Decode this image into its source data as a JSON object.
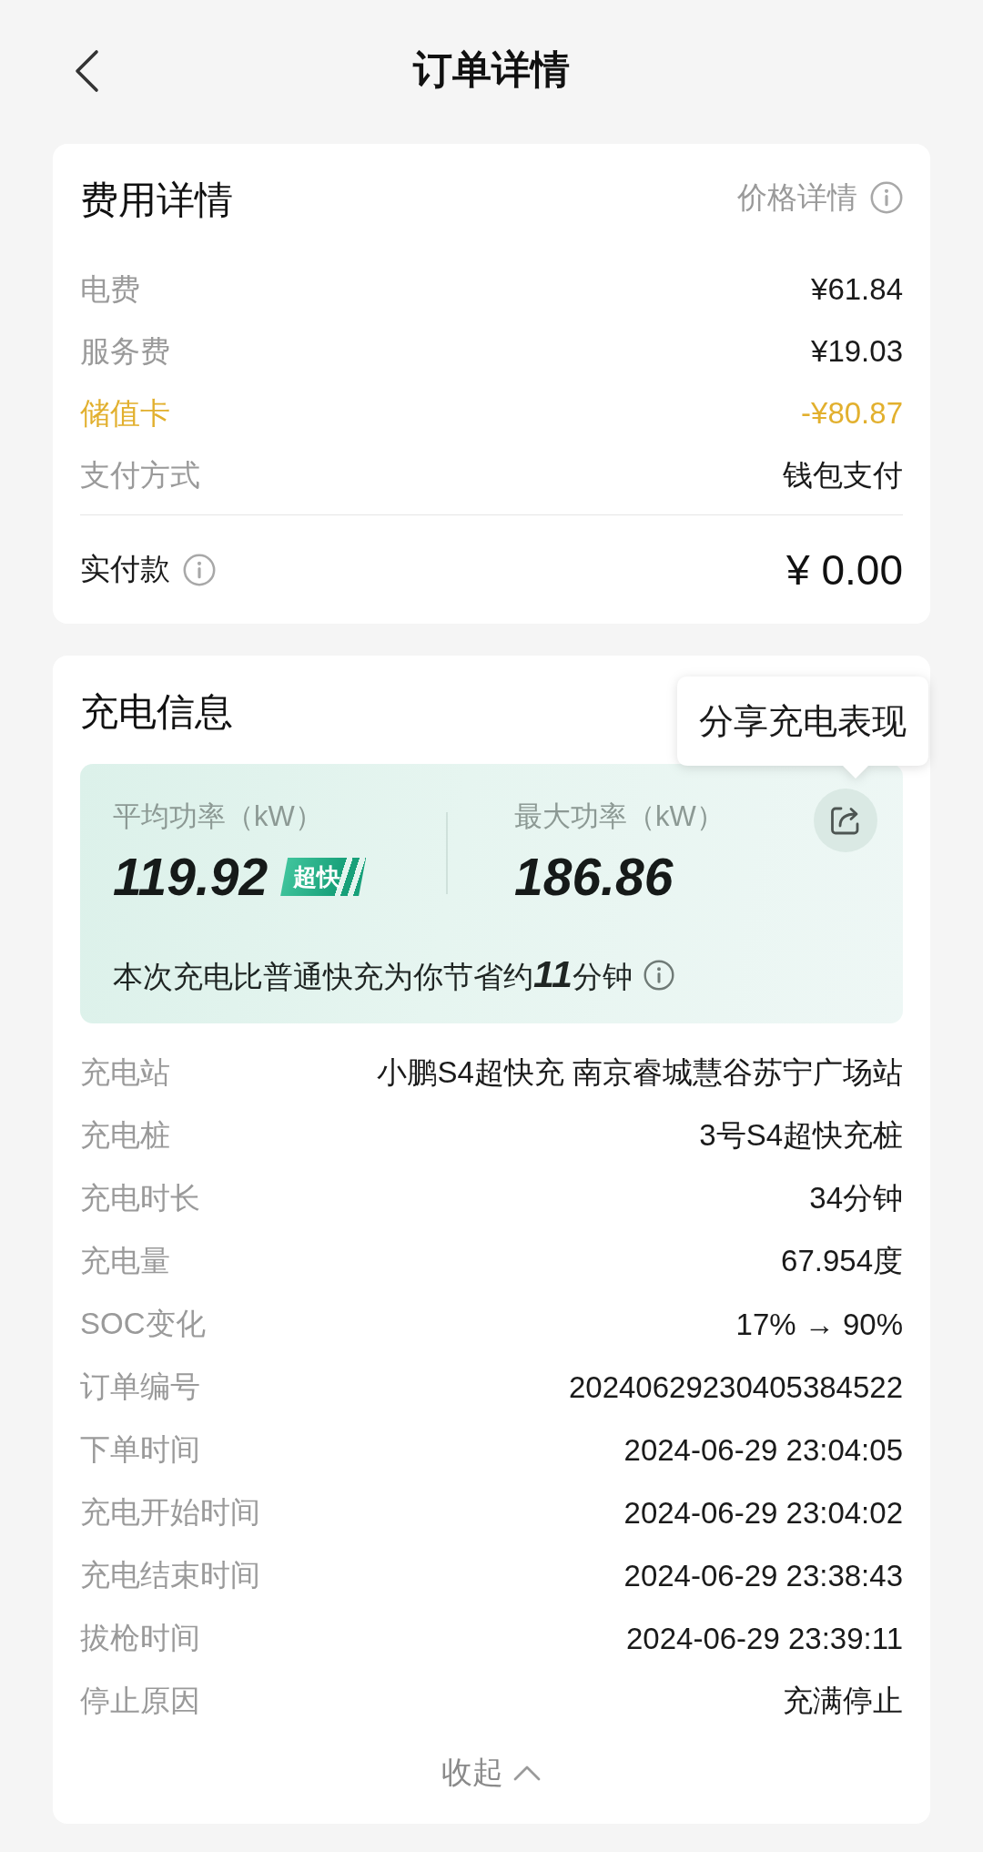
{
  "header": {
    "title": "订单详情"
  },
  "fee_details": {
    "title": "费用详情",
    "price_link": "价格详情",
    "rows": [
      {
        "label": "电费",
        "value": "¥61.84",
        "kind": "plain"
      },
      {
        "label": "服务费",
        "value": "¥19.03",
        "kind": "plain"
      },
      {
        "label": "储值卡",
        "value": "-¥80.87",
        "kind": "discount"
      },
      {
        "label": "支付方式",
        "value": "钱包支付",
        "kind": "plain"
      }
    ],
    "total": {
      "label": "实付款",
      "value": "¥ 0.00"
    }
  },
  "charging_info": {
    "title": "充电信息",
    "share_tooltip": "分享充电表现",
    "stats": [
      {
        "label": "平均功率（kW）",
        "value": "119.92",
        "badge": "超快"
      },
      {
        "label": "最大功率（kW）",
        "value": "186.86"
      }
    ],
    "savings_note": "本次充电比普通快充为你节省约**11**分钟",
    "rows": [
      {
        "label": "充电站",
        "value": "小鹏S4超快充 南京睿城慧谷苏宁广场站"
      },
      {
        "label": "充电桩",
        "value": "3号S4超快充桩"
      },
      {
        "label": "充电时长",
        "value": "34分钟"
      },
      {
        "label": "充电量",
        "value": "67.954度"
      },
      {
        "label": "SOC变化",
        "value": "17% → 90%"
      },
      {
        "label": "订单编号",
        "value": "20240629230405384522"
      },
      {
        "label": "下单时间",
        "value": "2024-06-29 23:04:05"
      },
      {
        "label": "充电开始时间",
        "value": "2024-06-29 23:04:02"
      },
      {
        "label": "充电结束时间",
        "value": "2024-06-29 23:38:43"
      },
      {
        "label": "拔枪时间",
        "value": "2024-06-29 23:39:11"
      },
      {
        "label": "停止原因",
        "value": "充满停止"
      }
    ],
    "collapse_link": "收起"
  }
}
